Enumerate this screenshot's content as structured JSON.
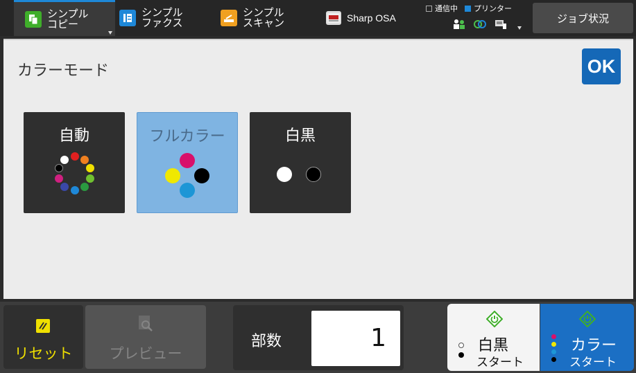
{
  "topbar": {
    "tabs": [
      {
        "label": "シンプル\nコピー",
        "icon": "copy-icon",
        "color": "#3fae2a"
      },
      {
        "label": "シンプル\nファクス",
        "icon": "fax-icon",
        "color": "#1e88d8"
      },
      {
        "label": "シンプル\nスキャン",
        "icon": "scan-icon",
        "color": "#f0a020"
      },
      {
        "label": "Sharp OSA",
        "icon": "osa-icon",
        "color": "#c02020"
      }
    ],
    "status": {
      "communicating": "通信中",
      "printer": "プリンター"
    },
    "job_status": "ジョブ状況"
  },
  "panel": {
    "title": "カラーモード",
    "ok": "OK",
    "modes": [
      {
        "label": "自動",
        "selected": false
      },
      {
        "label": "フルカラー",
        "selected": true
      },
      {
        "label": "白黒",
        "selected": false
      }
    ]
  },
  "bottombar": {
    "reset": "リセット",
    "preview": "プレビュー",
    "copies_label": "部数",
    "copies_value": "1",
    "bw_start": {
      "line1": "白黒",
      "line2": "スタート"
    },
    "color_start": {
      "line1": "カラー",
      "line2": "スタート"
    }
  },
  "colors": {
    "accent": "#1568b7",
    "selected_mode": "#7fb4e2",
    "reset_text": "#f0e000",
    "start_green": "#3fae2a"
  }
}
